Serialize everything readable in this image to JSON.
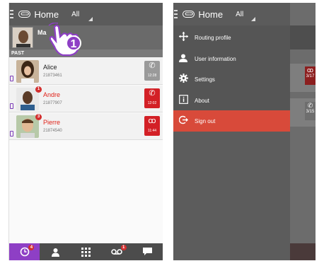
{
  "left": {
    "topbar": {
      "home": "Home",
      "all": "All"
    },
    "user": {
      "name": "Ma",
      "name_suffix": "s",
      "status": ""
    },
    "section": "PAST",
    "calls": [
      {
        "name": "Alice",
        "number": "21873461",
        "missed": false,
        "badge": "",
        "time": "12:28",
        "type": "phone",
        "tile": "gray"
      },
      {
        "name": "Andre",
        "number": "21877907",
        "missed": true,
        "badge": "1",
        "time": "12:02",
        "type": "phone",
        "tile": "red"
      },
      {
        "name": "Pierre",
        "number": "21874540",
        "missed": true,
        "badge": "3",
        "time": "11:44",
        "type": "voicemail",
        "tile": "red"
      }
    ],
    "nav": [
      {
        "name": "history",
        "badge": "4",
        "active": true
      },
      {
        "name": "contacts",
        "badge": "",
        "active": false
      },
      {
        "name": "dialpad",
        "badge": "",
        "active": false
      },
      {
        "name": "voicemail",
        "badge": "1",
        "active": false
      },
      {
        "name": "chat",
        "badge": "",
        "active": false
      }
    ],
    "tutorial_step": "1"
  },
  "right": {
    "topbar": {
      "home": "Home",
      "all": "All"
    },
    "menu": [
      {
        "label": "Routing profile",
        "icon": "routing-icon"
      },
      {
        "label": "User information",
        "icon": "user-icon"
      },
      {
        "label": "Settings",
        "icon": "gear-icon"
      },
      {
        "label": "About",
        "icon": "info-icon"
      },
      {
        "label": "Sign out",
        "icon": "sign-out-icon"
      }
    ],
    "shade_times": [
      "3/17",
      "3/15"
    ]
  },
  "colors": {
    "accent": "#8e3fc5",
    "missed": "#e0241b",
    "signout": "#d84a3a"
  }
}
